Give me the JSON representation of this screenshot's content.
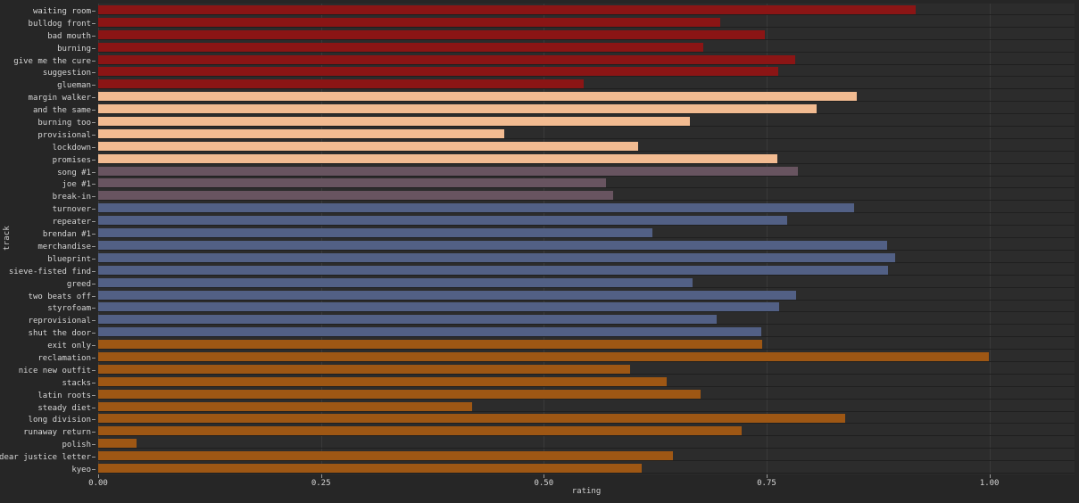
{
  "chart_data": {
    "type": "bar",
    "orientation": "horizontal",
    "title": "",
    "xlabel": "rating",
    "ylabel": "track",
    "xlim": [
      0.0,
      1.0955
    ],
    "xticks": [
      0.0,
      0.25,
      0.5,
      0.75,
      1.0
    ],
    "xticklabels": [
      "0.00",
      "0.25",
      "0.50",
      "0.75",
      "1.00"
    ],
    "grid": "vertical",
    "legend": "none",
    "background": "#262626",
    "plot_background": "#2c2c2c",
    "palette": {
      "dark_red": "#8b1515",
      "peach": "#f2bb91",
      "mauve": "#685460",
      "blue": "#526085",
      "orange": "#9e5714"
    },
    "categories": [
      "waiting room",
      "bulldog front",
      "bad mouth",
      "burning",
      "give me the cure",
      "suggestion",
      "glueman",
      "margin walker",
      "and the same",
      "burning too",
      "provisional",
      "lockdown",
      "promises",
      "song #1",
      "joe #1",
      "break-in",
      "turnover",
      "repeater",
      "brendan #1",
      "merchandise",
      "blueprint",
      "sieve-fisted find",
      "greed",
      "two beats off",
      "styrofoam",
      "reprovisional",
      "shut the door",
      "exit only",
      "reclamation",
      "nice new outfit",
      "stacks",
      "latin roots",
      "steady diet",
      "long division",
      "runaway return",
      "polish",
      "dear justice letter",
      "kyeo"
    ],
    "values": [
      0.917,
      0.698,
      0.748,
      0.679,
      0.782,
      0.763,
      0.545,
      0.851,
      0.806,
      0.664,
      0.456,
      0.606,
      0.762,
      0.785,
      0.57,
      0.578,
      0.848,
      0.773,
      0.622,
      0.885,
      0.894,
      0.886,
      0.667,
      0.783,
      0.764,
      0.694,
      0.744,
      0.745,
      0.999,
      0.597,
      0.638,
      0.676,
      0.42,
      0.838,
      0.722,
      0.043,
      0.645,
      0.61
    ],
    "colors": [
      "#8b1515",
      "#8b1515",
      "#8b1515",
      "#8b1515",
      "#8b1515",
      "#8b1515",
      "#8b1515",
      "#f2bb91",
      "#f2bb91",
      "#f2bb91",
      "#f2bb91",
      "#f2bb91",
      "#f2bb91",
      "#685460",
      "#685460",
      "#685460",
      "#526085",
      "#526085",
      "#526085",
      "#526085",
      "#526085",
      "#526085",
      "#526085",
      "#526085",
      "#526085",
      "#526085",
      "#526085",
      "#9e5714",
      "#9e5714",
      "#9e5714",
      "#9e5714",
      "#9e5714",
      "#9e5714",
      "#9e5714",
      "#9e5714",
      "#9e5714",
      "#9e5714",
      "#9e5714"
    ]
  }
}
